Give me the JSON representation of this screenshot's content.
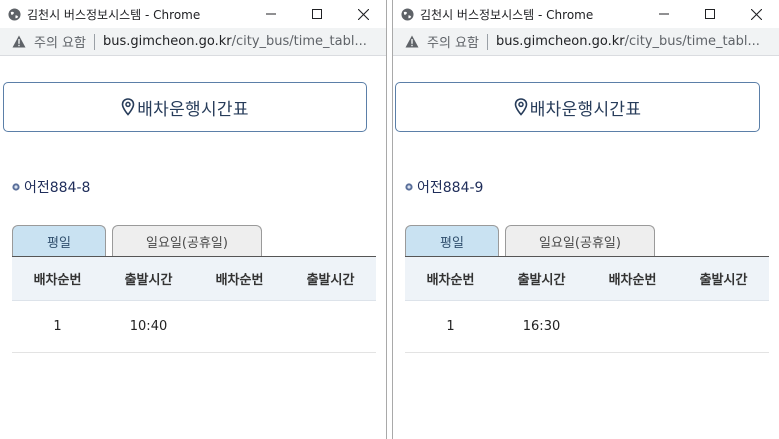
{
  "windows": [
    {
      "title": "김천시 버스정보시스템 - Chrome",
      "security_text": "주의 요함",
      "url_host": "bus.gimcheon.go.kr",
      "url_path": "/city_bus/time_tabl...",
      "header_title": "배차운행시간표",
      "route_name": "어전884-8",
      "tabs": [
        "평일",
        "일요일(공휴일)"
      ],
      "active_tab": "평일",
      "columns": [
        "배차순번",
        "출발시간",
        "배차순번",
        "출발시간"
      ],
      "rows": [
        [
          "1",
          "10:40",
          "",
          ""
        ]
      ]
    },
    {
      "title": "김천시 버스정보시스템 - Chrome",
      "security_text": "주의 요함",
      "url_host": "bus.gimcheon.go.kr",
      "url_path": "/city_bus/time_tabl...",
      "header_title": "배차운행시간표",
      "route_name": "어전884-9",
      "tabs": [
        "평일",
        "일요일(공휴일)"
      ],
      "active_tab": "평일",
      "columns": [
        "배차순번",
        "출발시간",
        "배차순번",
        "출발시간"
      ],
      "rows": [
        [
          "1",
          "16:30",
          "",
          ""
        ]
      ]
    }
  ],
  "icons": {
    "titlebar": "globe-icon",
    "controls": [
      "minimize-icon",
      "maximize-icon",
      "close-icon"
    ],
    "security": "warning-icon",
    "header": "location-pin-icon",
    "route": "route-bullet-icon"
  },
  "colors": {
    "header_border": "#5b7fa8",
    "header_text": "#273c5a",
    "active_tab_bg": "#c9e2f2",
    "inactive_tab_bg": "#eeeeee",
    "table_header_bg": "#eef3f8"
  }
}
